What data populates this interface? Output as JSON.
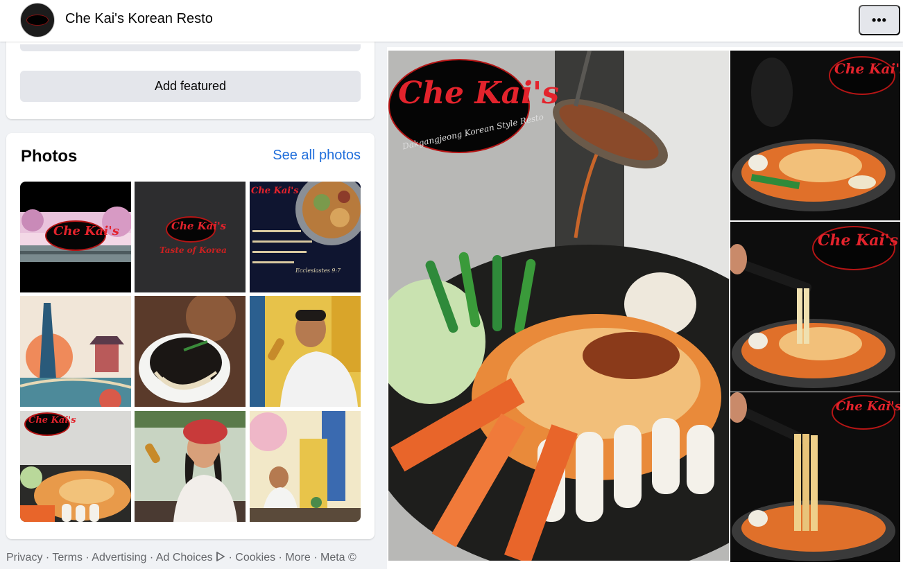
{
  "header": {
    "page_name": "Che Kai's Korean Resto",
    "more_label": "•••"
  },
  "featured": {
    "add_label": "Add featured"
  },
  "photos": {
    "title": "Photos",
    "see_all": "See all photos",
    "items": [
      {
        "alt": "Cherry blossom park with Che Kai's logo"
      },
      {
        "alt": "Che Kai's logo - Taste of Korea"
      },
      {
        "alt": "Food with bible verse"
      },
      {
        "alt": "Seoul tower mural"
      },
      {
        "alt": "Black bean noodles bowl"
      },
      {
        "alt": "Man eating corn dog"
      },
      {
        "alt": "Tteokbokki platter"
      },
      {
        "alt": "Woman eating corn dog"
      },
      {
        "alt": "Woman seated by mural"
      }
    ],
    "logo_text": "Che Kai's",
    "tile2_caption": "Taste of Korea",
    "tile3_caption": "Ecclesiastes 9:7"
  },
  "viewer": {
    "logo_text": "Che Kai's",
    "logo_sub": "Dakgangjeong Korean Style Resto"
  },
  "footer": {
    "links": [
      "Privacy",
      "Terms",
      "Advertising",
      "Ad Choices",
      "Cookies",
      "More"
    ],
    "meta": "Meta ©",
    "ad_choices_icon": "ad-choices-icon"
  },
  "colors": {
    "link_blue": "#216fdb",
    "button_grey": "#e4e6eb",
    "page_bg": "#f0f2f5",
    "brand_red": "#e3232c"
  }
}
